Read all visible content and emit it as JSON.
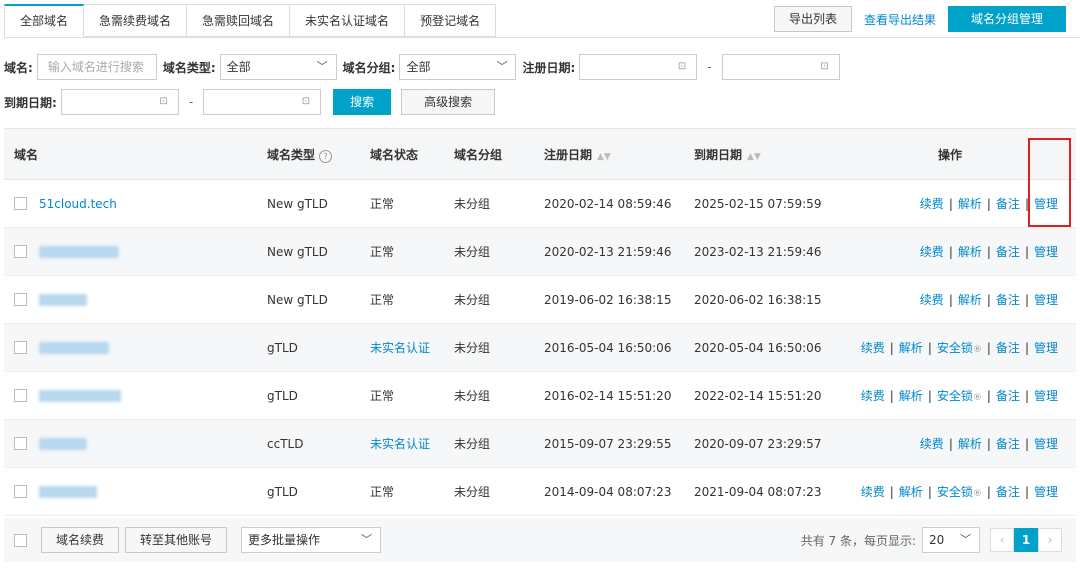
{
  "tabs": [
    "全部域名",
    "急需续费域名",
    "急需赎回域名",
    "未实名认证域名",
    "预登记域名"
  ],
  "top_actions": {
    "export_list": "导出列表",
    "view_export": "查看导出结果",
    "group_manage": "域名分组管理"
  },
  "filters": {
    "domain_label": "域名:",
    "domain_placeholder": "输入域名进行搜索",
    "type_label": "域名类型:",
    "type_value": "全部",
    "group_label": "域名分组:",
    "group_value": "全部",
    "reg_label": "注册日期:",
    "exp_label": "到期日期:",
    "dash": "-",
    "search": "搜索",
    "advanced": "高级搜索"
  },
  "table": {
    "headers": {
      "domain": "域名",
      "type": "域名类型",
      "status": "域名状态",
      "group": "域名分组",
      "reg": "注册日期",
      "exp": "到期日期",
      "ops": "操作"
    },
    "rows": [
      {
        "domain": "51cloud.tech",
        "type": "New gTLD",
        "status": "正常",
        "group": "未分组",
        "reg": "2020-02-14 08:59:46",
        "exp": "2025-02-15 07:59:59"
      },
      {
        "domain": "",
        "type": "New gTLD",
        "status": "正常",
        "group": "未分组",
        "reg": "2020-02-13 21:59:46",
        "exp": "2023-02-13 21:59:46"
      },
      {
        "domain": "",
        "type": "New gTLD",
        "status": "正常",
        "group": "未分组",
        "reg": "2019-06-02 16:38:15",
        "exp": "2020-06-02 16:38:15"
      },
      {
        "domain": "",
        "type": "gTLD",
        "status": "未实名认证",
        "group": "未分组",
        "reg": "2016-05-04 16:50:06",
        "exp": "2020-05-04 16:50:06"
      },
      {
        "domain": "",
        "type": "gTLD",
        "status": "正常",
        "group": "未分组",
        "reg": "2016-02-14 15:51:20",
        "exp": "2022-02-14 15:51:20"
      },
      {
        "domain": "",
        "type": "ccTLD",
        "status": "未实名认证",
        "group": "未分组",
        "reg": "2015-09-07 23:29:55",
        "exp": "2020-09-07 23:29:57"
      },
      {
        "domain": "",
        "type": "gTLD",
        "status": "正常",
        "group": "未分组",
        "reg": "2014-09-04 08:07:23",
        "exp": "2021-09-04 08:07:23"
      }
    ],
    "ops": {
      "renew": "续费",
      "resolve": "解析",
      "lock": "安全锁",
      "note": "备注",
      "manage": "管理"
    }
  },
  "footer": {
    "renew": "域名续费",
    "transfer": "转至其他账号",
    "more": "更多批量操作",
    "summary": "共有 7 条，每页显示:",
    "page_size": "20",
    "page": "1"
  },
  "colors": {
    "accent": "#00a2ca",
    "link": "#0088cc",
    "highlight": "#e02020"
  }
}
